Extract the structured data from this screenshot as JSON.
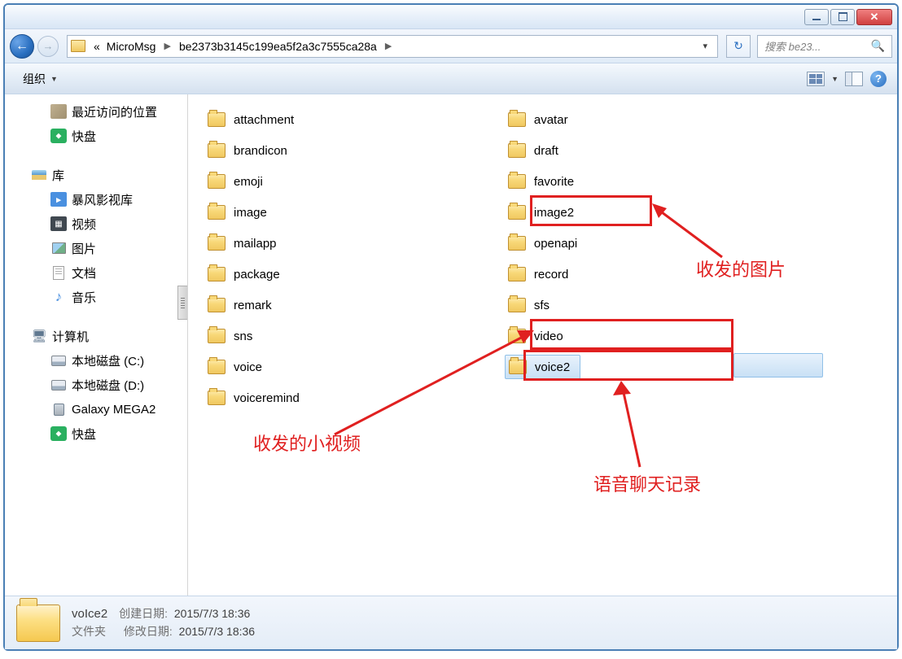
{
  "breadcrumb": {
    "ellipsis": "«",
    "seg1": "MicroMsg",
    "seg2": "be2373b3145c199ea5f2a3c7555ca28a"
  },
  "search": {
    "placeholder": "搜索 be23..."
  },
  "toolbar": {
    "organize": "组织"
  },
  "sidebar": {
    "recent": "最近访问的位置",
    "kuaipan": "快盘",
    "library": "库",
    "storm": "暴风影视库",
    "videos": "视频",
    "pictures": "图片",
    "documents": "文档",
    "music": "音乐",
    "computer": "计算机",
    "disk_c": "本地磁盘 (C:)",
    "disk_d": "本地磁盘 (D:)",
    "galaxy": "Galaxy MEGA2",
    "kuaipan2": "快盘"
  },
  "files_col1": [
    "attachment",
    "brandicon",
    "emoji",
    "image",
    "mailapp",
    "package",
    "remark",
    "sns",
    "voice",
    "voiceremind"
  ],
  "files_col2": [
    "avatar",
    "draft",
    "favorite",
    "image2",
    "openapi",
    "record",
    "sfs",
    "video",
    "voice2"
  ],
  "annotations": {
    "images": "收发的图片",
    "videos": "收发的小视频",
    "voice": "语音聊天记录"
  },
  "status": {
    "name": "voIce2",
    "type": "文件夹",
    "created_label": "创建日期:",
    "created_value": "2015/7/3 18:36",
    "modified_label": "修改日期:",
    "modified_value": "2015/7/3 18:36"
  }
}
